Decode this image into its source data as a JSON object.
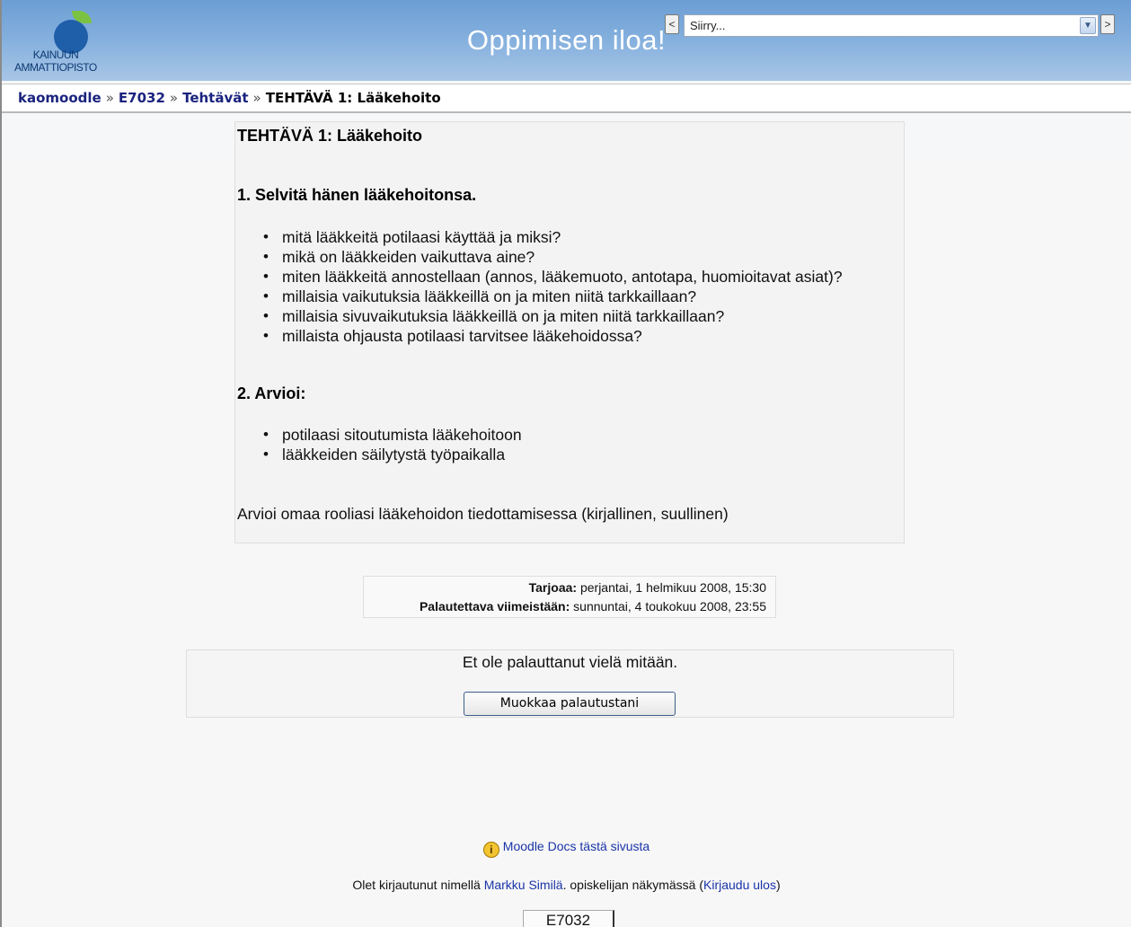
{
  "header": {
    "logo_line1": "KAINUUN",
    "logo_line2": "AMMATTIOPISTO",
    "site_title": "Oppimisen iloa!",
    "jump_prev": "<",
    "jump_next": ">",
    "jump_select_value": "Siirry..."
  },
  "breadcrumb": {
    "items": [
      "kaomoodle",
      "E7032",
      "Tehtävät"
    ],
    "separator": "»",
    "current": "TEHTÄVÄ 1: Lääkehoito"
  },
  "assignment": {
    "title": "TEHTÄVÄ 1: Lääkehoito",
    "section1": {
      "heading": "1. Selvitä hänen lääkehoitonsa.",
      "items": [
        "mitä lääkkeitä potilaasi käyttää ja miksi?",
        "mikä on lääkkeiden vaikuttava aine?",
        "miten lääkkeitä annostellaan (annos, lääkemuoto, antotapa, huomioitavat asiat)?",
        "millaisia vaikutuksia lääkkeillä on ja miten niitä tarkkaillaan?",
        "millaisia sivuvaikutuksia lääkkeillä on ja miten niitä tarkkaillaan?",
        "millaista ohjausta potilaasi tarvitsee lääkehoidossa?"
      ]
    },
    "section2": {
      "heading": "2. Arvioi:",
      "items": [
        "potilaasi sitoutumista lääkehoitoon",
        "lääkkeiden säilytystä työpaikalla"
      ]
    },
    "footer_text": "Arvioi omaa rooliasi lääkehoidon tiedottamisessa (kirjallinen, suullinen)"
  },
  "dates": {
    "available_label": "Tarjoaa:",
    "available_value": "perjantai, 1 helmikuu 2008, 15:30",
    "due_label": "Palautettava viimeistään:",
    "due_value": "sunnuntai, 4 toukokuu 2008, 23:55"
  },
  "submission": {
    "status_text": "Et ole palauttanut vielä mitään.",
    "edit_button": "Muokkaa palautustani"
  },
  "footer": {
    "docs_icon": "i",
    "docs_link": "Moodle Docs tästä sivusta",
    "login_prefix": "Olet kirjautunut nimellä",
    "user_name": "Markku Similä",
    "login_middle": ". opiskelijan näkymässä (",
    "logout_link": "Kirjaudu ulos",
    "login_suffix": ")",
    "course_button": "E7032"
  },
  "colors": {
    "header_top": "#6c9ed4",
    "header_bottom": "#a8c6e6",
    "link": "#1a237e",
    "logo_blue": "#1f5ea8",
    "logo_green": "#7cc242"
  }
}
